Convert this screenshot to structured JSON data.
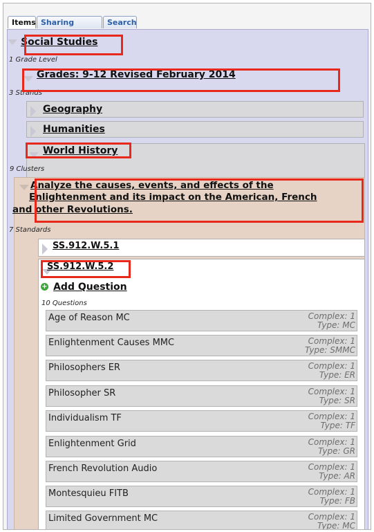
{
  "tabs": [
    "Items",
    "Sharing Options",
    "Search"
  ],
  "subject": {
    "title": "Social Studies",
    "grade_count": "1 Grade Level"
  },
  "grade": {
    "title": "Grades: 9-12 Revised February 2014",
    "strand_count": "3 Strands"
  },
  "strands": [
    {
      "label": "Geography"
    },
    {
      "label": "Humanities"
    },
    {
      "label": "World History",
      "cluster_count": "9 Clusters"
    }
  ],
  "cluster": {
    "lines": [
      "Analyze the causes, events, and effects of the",
      "Enlightenment and its impact on the American, French",
      "and other Revolutions."
    ],
    "standard_count": "7 Standards"
  },
  "standards": [
    {
      "label": "SS.912.W.5.1"
    },
    {
      "label": "SS.912.W.5.2"
    }
  ],
  "add_question": "Add Question",
  "question_count": "10 Questions",
  "questions": [
    {
      "name": "Age of Reason MC",
      "complex": "Complex: 1",
      "type": "Type: MC"
    },
    {
      "name": "Enlightenment Causes MMC",
      "complex": "Complex: 1",
      "type": "Type: SMMC"
    },
    {
      "name": "Philosophers ER",
      "complex": "Complex: 1",
      "type": "Type: ER"
    },
    {
      "name": "Philosopher SR",
      "complex": "Complex: 1",
      "type": "Type: SR"
    },
    {
      "name": "Individualism TF",
      "complex": "Complex: 1",
      "type": "Type: TF"
    },
    {
      "name": "Enlightenment Grid",
      "complex": "Complex: 1",
      "type": "Type: GR"
    },
    {
      "name": "French Revolution Audio",
      "complex": "Complex: 1",
      "type": "Type: AR"
    },
    {
      "name": "Montesquieu FITB",
      "complex": "Complex: 1",
      "type": "Type: FB"
    },
    {
      "name": "Limited Government MC",
      "complex": "Complex: 1",
      "type": "Type: MC"
    }
  ],
  "colors": {
    "highlight": "#e8281a",
    "panel": "#d8d8ef",
    "cluster_bg": "#e6d3c5"
  }
}
